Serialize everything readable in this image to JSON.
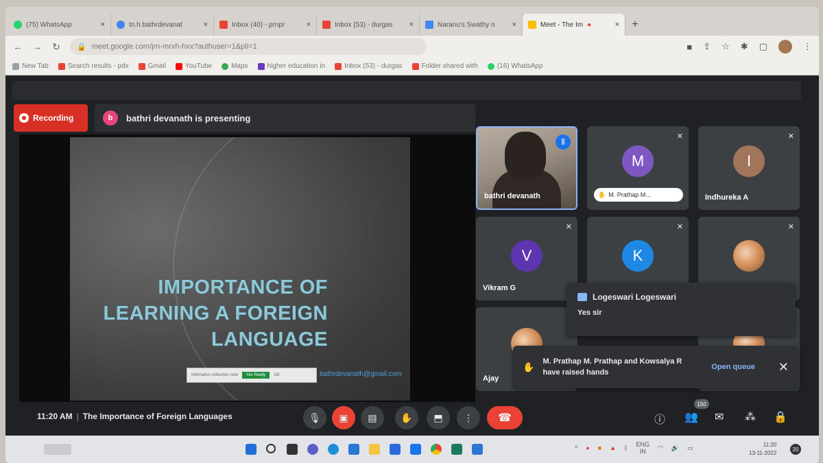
{
  "browser": {
    "tabs": [
      {
        "label": "(75) WhatsApp",
        "color": "#25d366"
      },
      {
        "label": "tn.h.bathrdevanat",
        "color": "#4285f4"
      },
      {
        "label": "Inbox (40) - prnpr",
        "color": "#ea4335"
      },
      {
        "label": "Inbox (53) - durgas",
        "color": "#ea4335"
      },
      {
        "label": "Naranu's Swathy n",
        "color": "#4285f4"
      },
      {
        "label": "Meet - The Im",
        "color": "#fbbc04"
      }
    ],
    "new_tab_label": "+",
    "url": "meet.google.com/jrn-mrxh-hxx?authuser=1&pli=1",
    "bookmarks": [
      {
        "label": "New Tab",
        "color": "#9aa0a6"
      },
      {
        "label": "Search results - pdx",
        "color": "#ea4335"
      },
      {
        "label": "Gmail",
        "color": "#ea4335"
      },
      {
        "label": "YouTube",
        "color": "#ff0000"
      },
      {
        "label": "Maps",
        "color": "#34a853"
      },
      {
        "label": "higher education in",
        "color": "#673ab7"
      },
      {
        "label": "Inbox (53) - durgas",
        "color": "#ea4335"
      },
      {
        "label": "Folder shared with",
        "color": "#ea4335"
      },
      {
        "label": "(16) WhatsApp",
        "color": "#25d366"
      }
    ]
  },
  "meet": {
    "recording_label": "Recording",
    "presenting_text": "bathri devanath is presenting",
    "presenter_initial": "b",
    "slide": {
      "title_lines": [
        "IMPORTANCE OF",
        "LEARNING  A FOREIGN",
        "LANGUAGE"
      ],
      "cookie_text": "Infomation collection note",
      "cookie_button": "Yes Really",
      "cookie_ok": "OK",
      "link_text": "bathrdevanath@gmail.com"
    },
    "tiles": [
      {
        "name": "bathri devanath"
      },
      {
        "name": "M. Prathap M...",
        "initial": "M",
        "color": "#7e57c2"
      },
      {
        "name": "Indhureka A",
        "initial": "I",
        "color": "#a1755a"
      },
      {
        "name": "Vikram G",
        "initial": "V",
        "color": "#5e35b1"
      },
      {
        "name": "",
        "initial": "K",
        "color": "#1e88e5"
      },
      {
        "name": "Ajay"
      }
    ],
    "chat": {
      "from": "Logeswari Logeswari",
      "message": "Yes sir"
    },
    "hands": {
      "text": "M. Prathap M. Prathap and Kowsalya R have raised hands",
      "queue_label": "Open queue"
    },
    "time": "11:20 AM",
    "meeting_title": "The Importance of Foreign Languages",
    "participant_count": "150"
  },
  "taskbar": {
    "search_label": "...",
    "lang": "ENG",
    "region": "IN",
    "time": "11:20",
    "date": "13-11-2022",
    "notifications": "20"
  }
}
